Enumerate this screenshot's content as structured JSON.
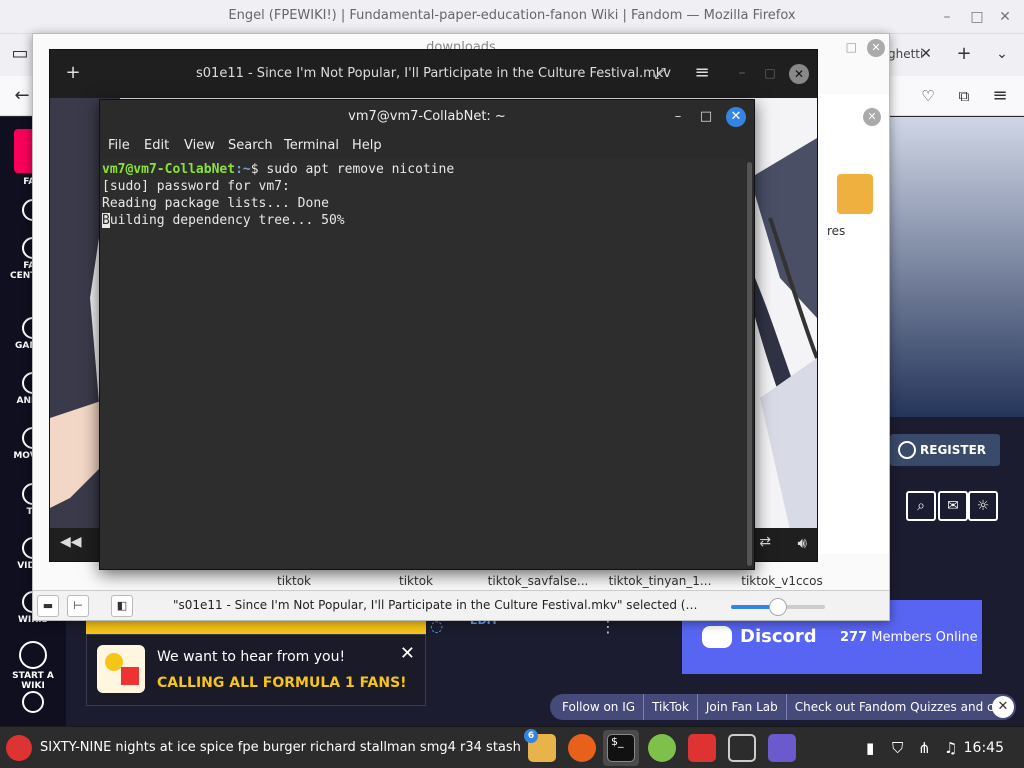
{
  "firefox": {
    "window_title": "Engel (FPEWIKI!) | Fundamental-paper-education-fanon Wiki | Fandom — Mozilla Firefox",
    "tab_partial": "ghetti",
    "register_label": "REGISTER",
    "edit_label": "EDIT",
    "sidebar": [
      {
        "label": "FAN"
      },
      {
        "label": "FAN CENTRAL"
      },
      {
        "label": "GAMES"
      },
      {
        "label": "ANIME"
      },
      {
        "label": "MOVIES"
      },
      {
        "label": "TV"
      },
      {
        "label": "VIDEO"
      },
      {
        "label": "WIKIS"
      },
      {
        "label": "START A WIKI"
      }
    ],
    "discord": {
      "name": "Discord",
      "count": "277",
      "count_suffix": "Members Online"
    },
    "notification": {
      "line1": "We want to hear from you!",
      "line2": "CALLING ALL FORMULA 1 FANS!"
    },
    "follow_bar": [
      "Follow on IG",
      "TikTok",
      "Join Fan Lab",
      "Check out Fandom Quizzes and cha"
    ]
  },
  "files": {
    "window_title": "downloads",
    "folder_label": "res",
    "filenames": [
      "tiktok",
      "tiktok",
      "tiktok_savfalse...",
      "tiktok_tinyan_1...",
      "tiktok_v1ccos"
    ],
    "status_text": "\"s01e11 - Since I'm Not Popular, I'll Participate in the Culture Festival.mkv\" selected (…",
    "zoom_level": 0.5
  },
  "player": {
    "title": "s01e11 - Since I'm Not Popular, I'll Participate in the Culture Festival.mkv"
  },
  "terminal": {
    "title": "vm7@vm7-CollabNet: ~",
    "menu": [
      "File",
      "Edit",
      "View",
      "Search",
      "Terminal",
      "Help"
    ],
    "prompt_user": "vm7@vm7-CollabNet",
    "prompt_path": ":~",
    "prompt_symbol": "$ ",
    "command": "sudo apt remove nicotine",
    "lines": [
      "[sudo] password for vm7:",
      "Reading package lists... Done"
    ],
    "last_line_first_char": "B",
    "last_line_rest": "uilding dependency tree... 50%"
  },
  "taskbar": {
    "active_title": "SIXTY-NINE nights at ice spice fpe burger richard stallman smg4 r34 stash",
    "badge_count": "6",
    "clock": "16:45"
  },
  "colors": {
    "terminal_bg": "#2d2d2d",
    "prompt_user": "#8ae234",
    "prompt_path": "#729fcf",
    "accent": "#3584e4",
    "discord": "#5865f2",
    "fandom_yellow": "#f5c518"
  }
}
